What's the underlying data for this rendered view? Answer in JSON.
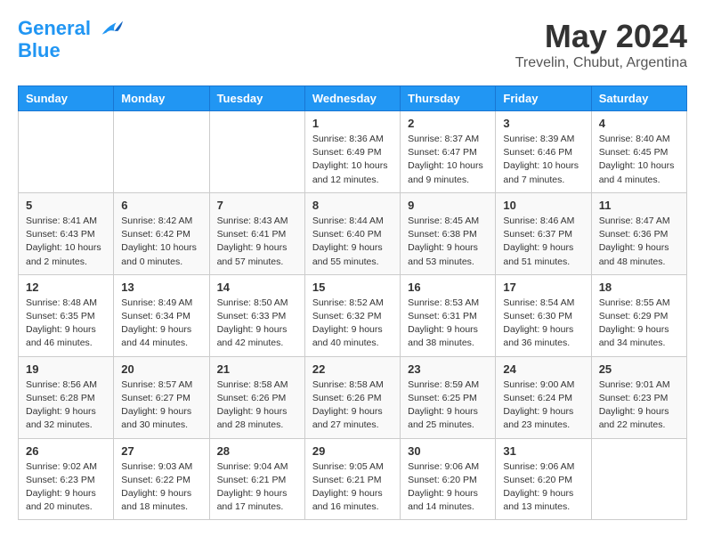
{
  "header": {
    "logo_line1": "General",
    "logo_line2": "Blue",
    "month": "May 2024",
    "location": "Trevelin, Chubut, Argentina"
  },
  "weekdays": [
    "Sunday",
    "Monday",
    "Tuesday",
    "Wednesday",
    "Thursday",
    "Friday",
    "Saturday"
  ],
  "weeks": [
    [
      {
        "day": "",
        "info": ""
      },
      {
        "day": "",
        "info": ""
      },
      {
        "day": "",
        "info": ""
      },
      {
        "day": "1",
        "info": "Sunrise: 8:36 AM\nSunset: 6:49 PM\nDaylight: 10 hours and 12 minutes."
      },
      {
        "day": "2",
        "info": "Sunrise: 8:37 AM\nSunset: 6:47 PM\nDaylight: 10 hours and 9 minutes."
      },
      {
        "day": "3",
        "info": "Sunrise: 8:39 AM\nSunset: 6:46 PM\nDaylight: 10 hours and 7 minutes."
      },
      {
        "day": "4",
        "info": "Sunrise: 8:40 AM\nSunset: 6:45 PM\nDaylight: 10 hours and 4 minutes."
      }
    ],
    [
      {
        "day": "5",
        "info": "Sunrise: 8:41 AM\nSunset: 6:43 PM\nDaylight: 10 hours and 2 minutes."
      },
      {
        "day": "6",
        "info": "Sunrise: 8:42 AM\nSunset: 6:42 PM\nDaylight: 10 hours and 0 minutes."
      },
      {
        "day": "7",
        "info": "Sunrise: 8:43 AM\nSunset: 6:41 PM\nDaylight: 9 hours and 57 minutes."
      },
      {
        "day": "8",
        "info": "Sunrise: 8:44 AM\nSunset: 6:40 PM\nDaylight: 9 hours and 55 minutes."
      },
      {
        "day": "9",
        "info": "Sunrise: 8:45 AM\nSunset: 6:38 PM\nDaylight: 9 hours and 53 minutes."
      },
      {
        "day": "10",
        "info": "Sunrise: 8:46 AM\nSunset: 6:37 PM\nDaylight: 9 hours and 51 minutes."
      },
      {
        "day": "11",
        "info": "Sunrise: 8:47 AM\nSunset: 6:36 PM\nDaylight: 9 hours and 48 minutes."
      }
    ],
    [
      {
        "day": "12",
        "info": "Sunrise: 8:48 AM\nSunset: 6:35 PM\nDaylight: 9 hours and 46 minutes."
      },
      {
        "day": "13",
        "info": "Sunrise: 8:49 AM\nSunset: 6:34 PM\nDaylight: 9 hours and 44 minutes."
      },
      {
        "day": "14",
        "info": "Sunrise: 8:50 AM\nSunset: 6:33 PM\nDaylight: 9 hours and 42 minutes."
      },
      {
        "day": "15",
        "info": "Sunrise: 8:52 AM\nSunset: 6:32 PM\nDaylight: 9 hours and 40 minutes."
      },
      {
        "day": "16",
        "info": "Sunrise: 8:53 AM\nSunset: 6:31 PM\nDaylight: 9 hours and 38 minutes."
      },
      {
        "day": "17",
        "info": "Sunrise: 8:54 AM\nSunset: 6:30 PM\nDaylight: 9 hours and 36 minutes."
      },
      {
        "day": "18",
        "info": "Sunrise: 8:55 AM\nSunset: 6:29 PM\nDaylight: 9 hours and 34 minutes."
      }
    ],
    [
      {
        "day": "19",
        "info": "Sunrise: 8:56 AM\nSunset: 6:28 PM\nDaylight: 9 hours and 32 minutes."
      },
      {
        "day": "20",
        "info": "Sunrise: 8:57 AM\nSunset: 6:27 PM\nDaylight: 9 hours and 30 minutes."
      },
      {
        "day": "21",
        "info": "Sunrise: 8:58 AM\nSunset: 6:26 PM\nDaylight: 9 hours and 28 minutes."
      },
      {
        "day": "22",
        "info": "Sunrise: 8:58 AM\nSunset: 6:26 PM\nDaylight: 9 hours and 27 minutes."
      },
      {
        "day": "23",
        "info": "Sunrise: 8:59 AM\nSunset: 6:25 PM\nDaylight: 9 hours and 25 minutes."
      },
      {
        "day": "24",
        "info": "Sunrise: 9:00 AM\nSunset: 6:24 PM\nDaylight: 9 hours and 23 minutes."
      },
      {
        "day": "25",
        "info": "Sunrise: 9:01 AM\nSunset: 6:23 PM\nDaylight: 9 hours and 22 minutes."
      }
    ],
    [
      {
        "day": "26",
        "info": "Sunrise: 9:02 AM\nSunset: 6:23 PM\nDaylight: 9 hours and 20 minutes."
      },
      {
        "day": "27",
        "info": "Sunrise: 9:03 AM\nSunset: 6:22 PM\nDaylight: 9 hours and 18 minutes."
      },
      {
        "day": "28",
        "info": "Sunrise: 9:04 AM\nSunset: 6:21 PM\nDaylight: 9 hours and 17 minutes."
      },
      {
        "day": "29",
        "info": "Sunrise: 9:05 AM\nSunset: 6:21 PM\nDaylight: 9 hours and 16 minutes."
      },
      {
        "day": "30",
        "info": "Sunrise: 9:06 AM\nSunset: 6:20 PM\nDaylight: 9 hours and 14 minutes."
      },
      {
        "day": "31",
        "info": "Sunrise: 9:06 AM\nSunset: 6:20 PM\nDaylight: 9 hours and 13 minutes."
      },
      {
        "day": "",
        "info": ""
      }
    ]
  ]
}
